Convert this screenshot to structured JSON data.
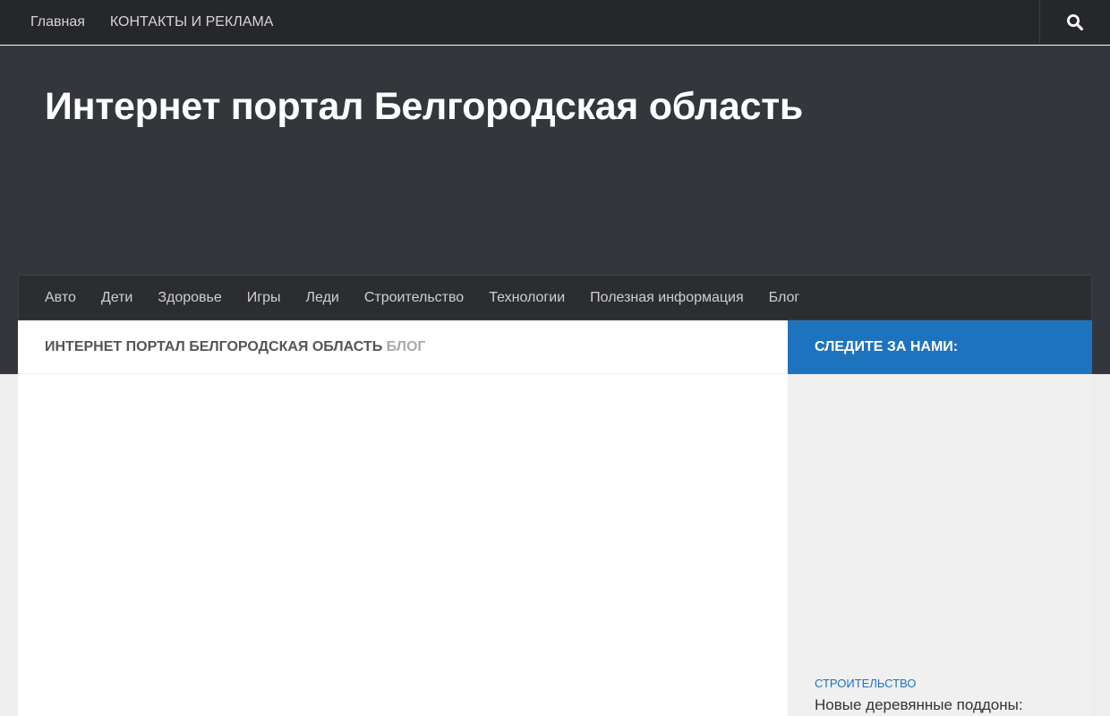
{
  "topbar": {
    "links": [
      {
        "label": "Главная"
      },
      {
        "label": "КОНТАКТЫ И РЕКЛАМА"
      }
    ],
    "search_icon": "search-icon"
  },
  "header": {
    "site_title": "Интернет портал Белгородская область"
  },
  "main_nav": {
    "items": [
      {
        "label": "Авто"
      },
      {
        "label": "Дети"
      },
      {
        "label": "Здоровье"
      },
      {
        "label": "Игры"
      },
      {
        "label": "Леди"
      },
      {
        "label": "Строительство"
      },
      {
        "label": "Технологии"
      },
      {
        "label": "Полезная информация"
      },
      {
        "label": "Блог"
      }
    ]
  },
  "breadcrumb": {
    "site": "Интернет портал Белгородская область",
    "page": "Блог"
  },
  "sidebar": {
    "follow_heading": "Следите за нами:",
    "post": {
      "category": "Строительство",
      "title": "Новые деревянные поддоны:"
    }
  },
  "colors": {
    "topbar_bg": "#26272b",
    "header_bg": "#33363b",
    "accent_blue": "#1e73be",
    "page_bg": "#eeeeee"
  }
}
